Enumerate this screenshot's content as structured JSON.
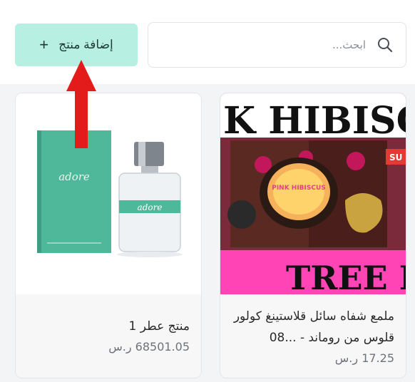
{
  "toolbar": {
    "add_label": "إضافة منتج",
    "add_icon": "plus-icon",
    "search_placeholder": "ابحث...",
    "search_icon": "search-icon"
  },
  "products": [
    {
      "name": "ملمع شفاه سائل قلاستينغ كولور قلوس من روماند - ...08",
      "price": "17.25 ر.س",
      "image_text": "K HIBISC",
      "image_text_bottom": "TREE I",
      "image_badge": "SU",
      "jar_label": "PINK HIBISCUS"
    },
    {
      "name": "منتج عطر 1",
      "price": "68501.05 ر.س",
      "box_brand": "adore",
      "bottle_brand": "adore"
    }
  ],
  "colors": {
    "accent": "#b8efe3",
    "annotation_arrow": "#e31b1b",
    "hero_pink": "#ff3fb4",
    "perfume_box": "#4fb89a"
  }
}
